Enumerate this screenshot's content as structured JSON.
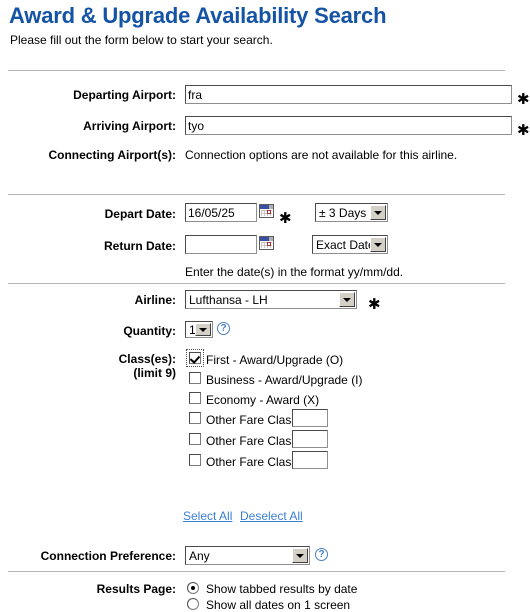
{
  "header": {
    "title": "Award & Upgrade Availability Search",
    "subtitle": "Please fill out the form below to start your search.",
    "title_color": "#1554a5"
  },
  "route_section": {
    "departing_label": "Departing Airport:",
    "departing_value": "fra",
    "departing_required_mark": "✱",
    "arriving_label": "Arriving Airport:",
    "arriving_value": "tyo",
    "arriving_required_mark": "✱",
    "connecting_label": "Connecting Airport(s):",
    "connecting_note": "Connection options are not available for this airline."
  },
  "date_section": {
    "depart_label": "Depart Date:",
    "depart_value": "16/05/25",
    "depart_required_mark": "✱",
    "depart_range_selected": "± 3 Days",
    "depart_calendar_icon": "calendar-icon",
    "return_label": "Return Date:",
    "return_value": "",
    "return_range_selected": "Exact Date",
    "return_calendar_icon": "calendar-icon",
    "format_hint": "Enter the date(s) in the format yy/mm/dd."
  },
  "airline_section": {
    "airline_label": "Airline:",
    "airline_selected": "Lufthansa - LH",
    "airline_required_mark": "✱",
    "quantity_label": "Quantity:",
    "quantity_selected": "1",
    "quantity_help_icon": "help-icon",
    "classes_label": "Class(es):",
    "classes_limit_label": "(limit 9)",
    "classes": [
      {
        "label": "First - Award/Upgrade (O)",
        "checked": true,
        "has_input": false,
        "value": ""
      },
      {
        "label": "Business - Award/Upgrade (I)",
        "checked": false,
        "has_input": false,
        "value": ""
      },
      {
        "label": "Economy - Award (X)",
        "checked": false,
        "has_input": false,
        "value": ""
      },
      {
        "label": "Other Fare Class:",
        "checked": false,
        "has_input": true,
        "value": ""
      },
      {
        "label": "Other Fare Class:",
        "checked": false,
        "has_input": true,
        "value": ""
      },
      {
        "label": "Other Fare Class:",
        "checked": false,
        "has_input": true,
        "value": ""
      }
    ],
    "select_all_label": "Select All",
    "deselect_all_label": "Deselect All",
    "link_color": "#3b7fd4",
    "connection_pref_label": "Connection Preference:",
    "connection_pref_selected": "Any",
    "connection_pref_help_icon": "help-icon"
  },
  "results_section": {
    "results_page_label": "Results Page:",
    "options": [
      {
        "label": "Show tabbed results by date",
        "selected": true
      },
      {
        "label": "Show all dates on 1 screen",
        "selected": false
      }
    ]
  }
}
